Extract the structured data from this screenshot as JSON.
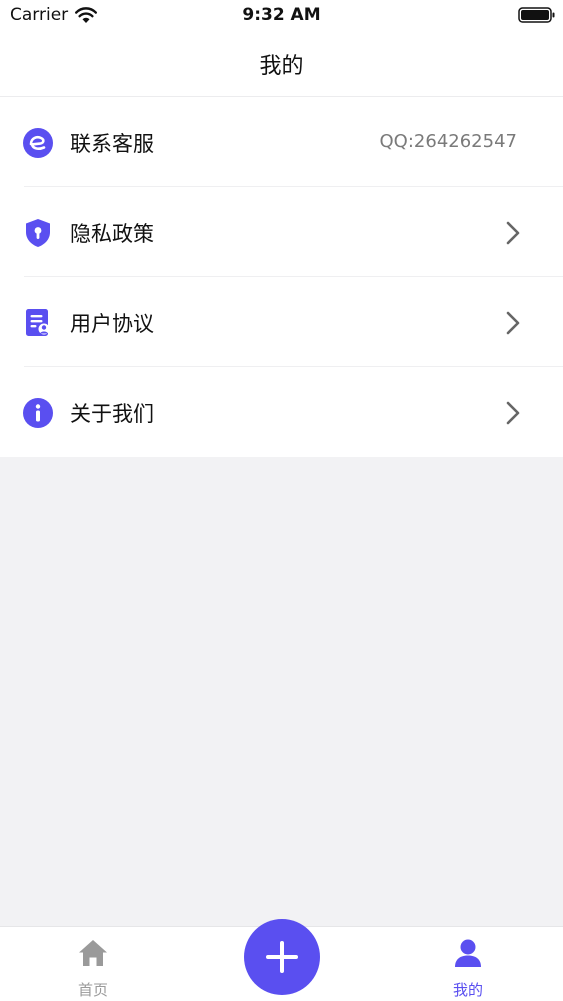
{
  "status_bar": {
    "carrier": "Carrier",
    "time": "9:32 AM"
  },
  "nav": {
    "title": "我的"
  },
  "menu": {
    "items": [
      {
        "label": "联系客服",
        "value": "QQ:264262547",
        "icon": "service-icon"
      },
      {
        "label": "隐私政策",
        "icon": "shield-lock-icon"
      },
      {
        "label": "用户协议",
        "icon": "document-user-icon"
      },
      {
        "label": "关于我们",
        "icon": "info-icon"
      }
    ]
  },
  "tab_bar": {
    "home_label": "首页",
    "mine_label": "我的",
    "add_icon": "plus-icon"
  },
  "colors": {
    "accent": "#5a4ff0",
    "inactive": "#9a9a9a",
    "background": "#f2f2f4"
  }
}
